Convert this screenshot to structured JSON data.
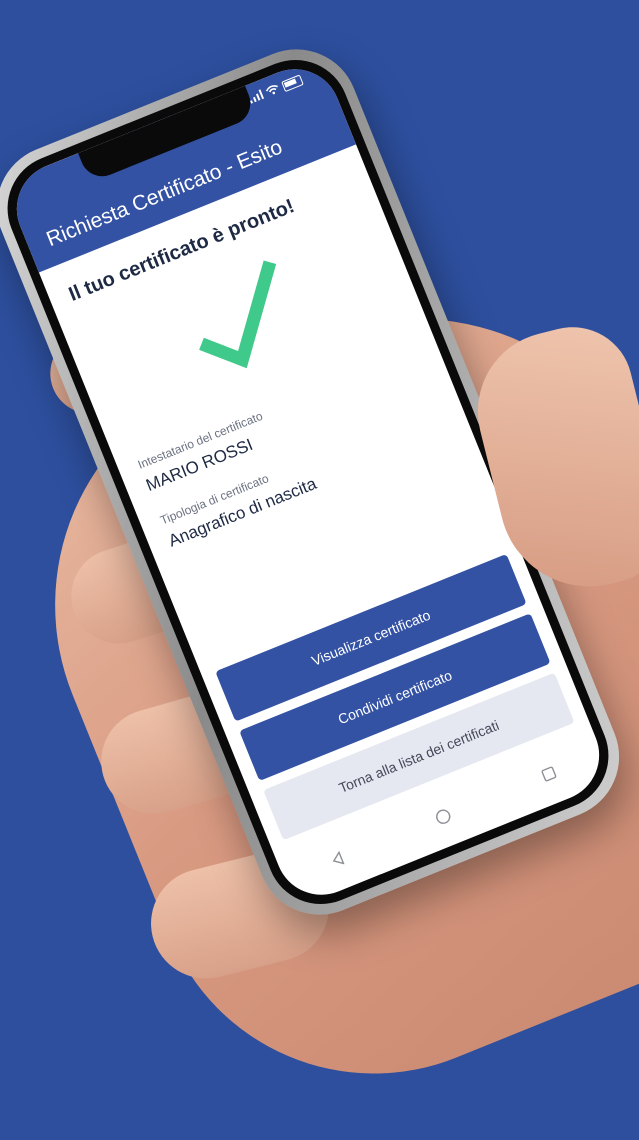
{
  "status_bar": {
    "signal_icon": "signal-bars-icon",
    "wifi_icon": "wifi-icon",
    "battery_icon": "battery-icon"
  },
  "header": {
    "title": "Richiesta Certificato - Esito"
  },
  "result": {
    "headline": "Il tuo certificato è pronto!",
    "check_icon": "checkmark-icon",
    "check_color": "#3fc98a"
  },
  "details": {
    "holder_label": "Intestatario del certificato",
    "holder_value": "MARIO ROSSI",
    "type_label": "Tipologia di certificato",
    "type_value": "Anagrafico di nascita"
  },
  "actions": {
    "view_label": "Visualizza certificato",
    "share_label": "Condividi certificato",
    "back_label": "Torna alla lista dei certificati"
  },
  "nav": {
    "back_icon": "triangle-back-icon",
    "home_icon": "circle-home-icon",
    "recents_icon": "square-recents-icon"
  },
  "colors": {
    "background": "#2d4f9e",
    "primary": "#3452a4",
    "secondary_button": "#e6e8f1"
  }
}
